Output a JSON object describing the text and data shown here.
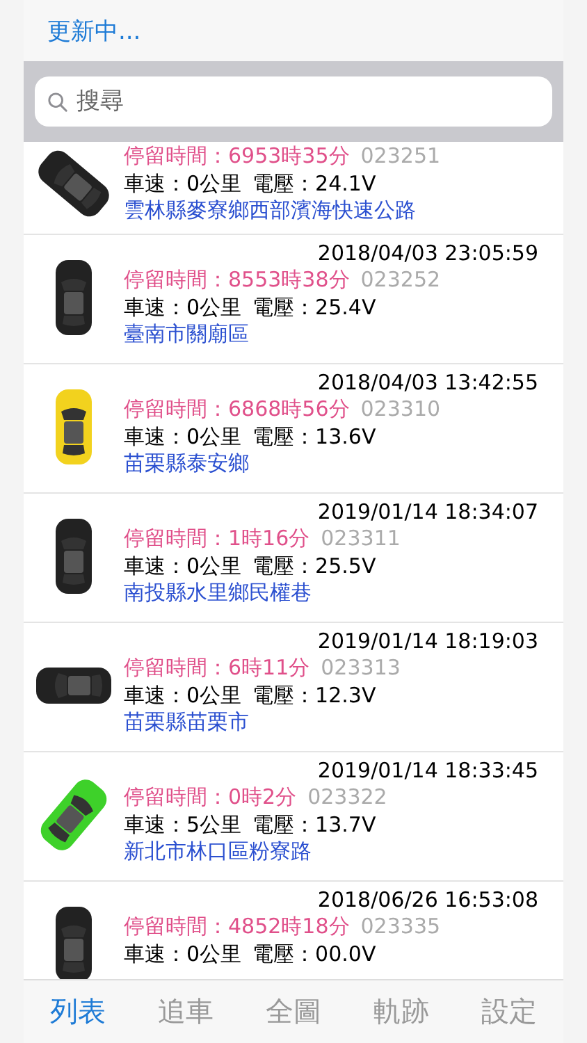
{
  "header": {
    "status": "更新中..."
  },
  "search": {
    "placeholder": "搜尋"
  },
  "rows": [
    {
      "stay": "停留時間：6953時35分",
      "id": "023251",
      "speed": "車速：0公里",
      "voltage": "電壓：24.1V",
      "address": "雲林縣麥寮鄉西部濱海快速公路",
      "color": "#222222",
      "kind": "tiltleft"
    },
    {
      "date": "2018/04/03 23:05:59",
      "stay": "停留時間：8553時38分",
      "id": "023252",
      "speed": "車速：0公里",
      "voltage": "電壓：25.4V",
      "address": "臺南市關廟區",
      "color": "#222222",
      "kind": "upright"
    },
    {
      "date": "2018/04/03 13:42:55",
      "stay": "停留時間：6868時56分",
      "id": "023310",
      "speed": "車速：0公里",
      "voltage": "電壓：13.6V",
      "address": "苗栗縣泰安鄉",
      "color": "#f2d21e",
      "kind": "upright"
    },
    {
      "date": "2019/01/14 18:34:07",
      "stay": "停留時間：1時16分",
      "id": "023311",
      "speed": "車速：0公里",
      "voltage": "電壓：25.5V",
      "address": "南投縣水里鄉民權巷",
      "color": "#222222",
      "kind": "upright"
    },
    {
      "date": "2019/01/14 18:19:03",
      "stay": "停留時間：6時11分",
      "id": "023313",
      "speed": "車速：0公里",
      "voltage": "電壓：12.3V",
      "address": "苗栗縣苗栗市",
      "color": "#222222",
      "kind": "sideways"
    },
    {
      "date": "2019/01/14 18:33:45",
      "stay": "停留時間：0時2分",
      "id": "023322",
      "speed": "車速：5公里",
      "voltage": "電壓：13.7V",
      "address": "新北市林口區粉寮路",
      "color": "#3ed12a",
      "kind": "tiltright"
    },
    {
      "date": "2018/06/26 16:53:08",
      "stay": "停留時間：4852時18分",
      "id": "023335",
      "speed": "車速：0公里",
      "voltage": "電壓：00.0V",
      "color": "#222222",
      "kind": "upright"
    }
  ],
  "tabs": [
    {
      "label": "列表",
      "selected": true
    },
    {
      "label": "追車",
      "selected": false
    },
    {
      "label": "全圖",
      "selected": false
    },
    {
      "label": "軌跡",
      "selected": false
    },
    {
      "label": "設定",
      "selected": false
    }
  ]
}
